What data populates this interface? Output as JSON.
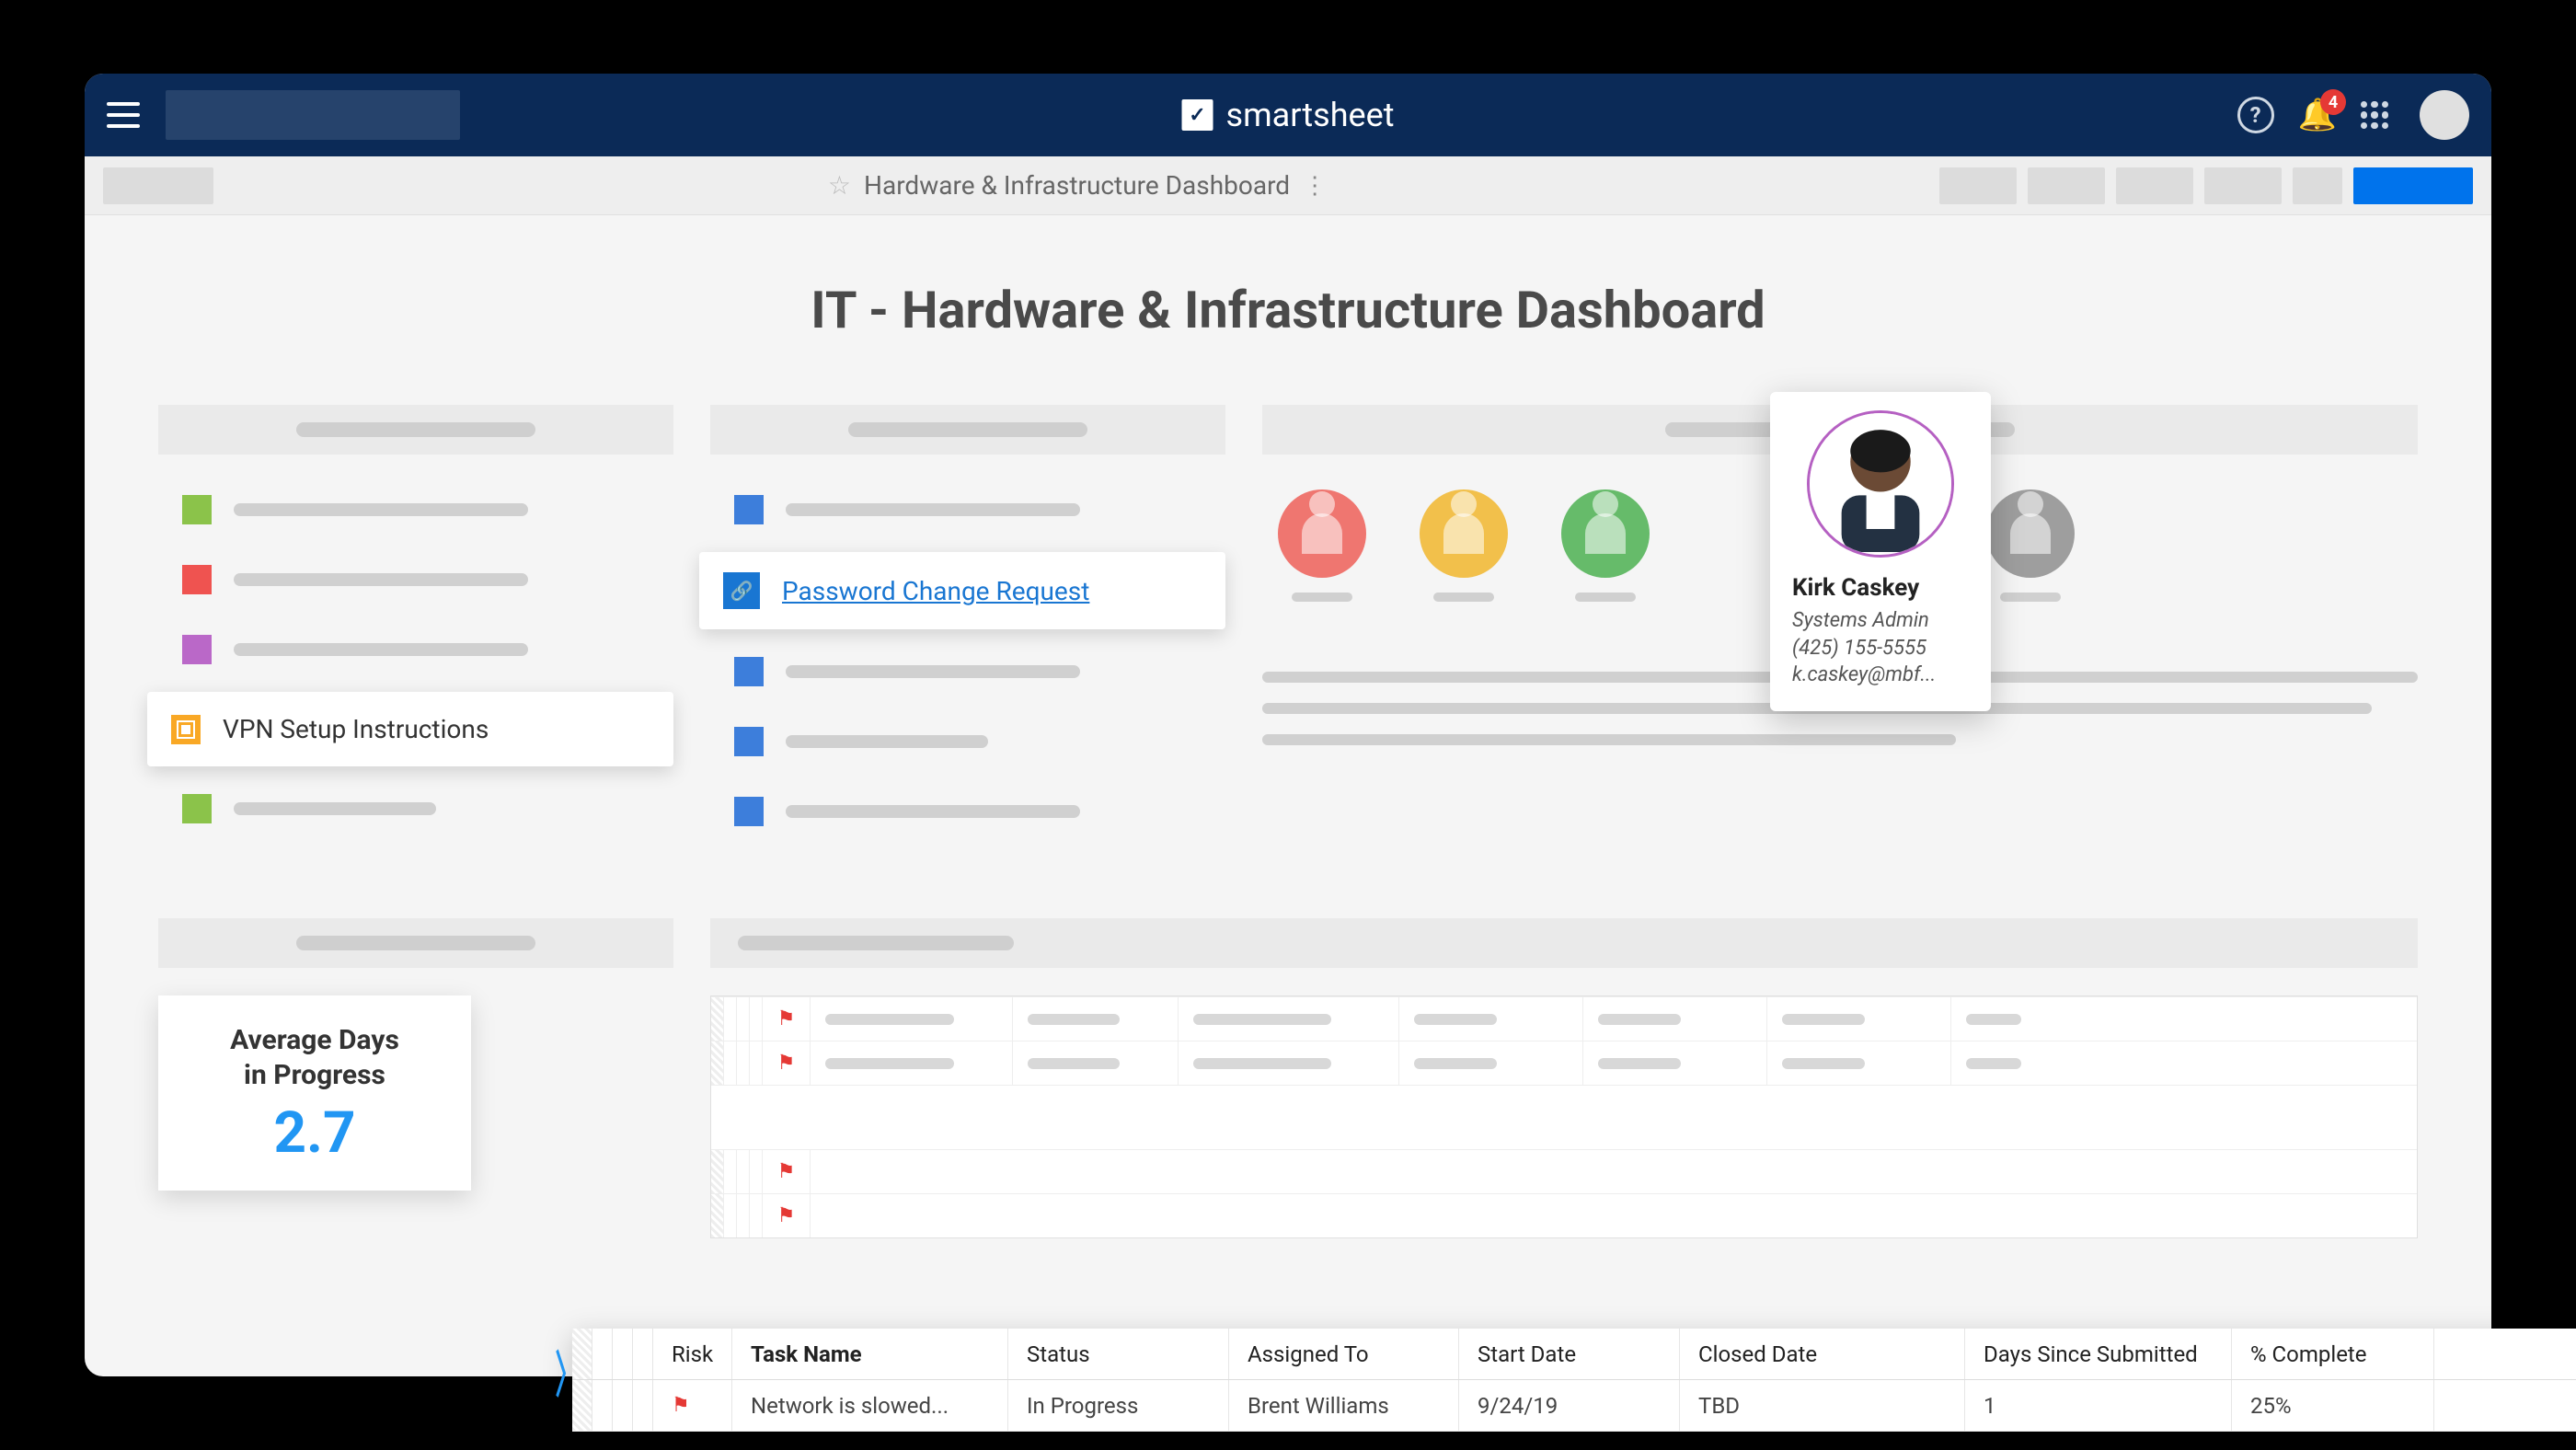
{
  "nav": {
    "brand": "smartsheet",
    "notification_count": "4"
  },
  "toolbar": {
    "title": "Hardware & Infrastructure Dashboard"
  },
  "page": {
    "title": "IT - Hardware & Infrastructure Dashboard"
  },
  "links": {
    "vpn": "VPN Setup Instructions",
    "password_change": "Password Change Request"
  },
  "popover": {
    "name": "Kirk Caskey",
    "role": "Systems Admin",
    "phone": "(425) 155-5555",
    "email": "k.caskey@mbf..."
  },
  "metric": {
    "label_line1": "Average Days",
    "label_line2": "in Progress",
    "value": "2.7"
  },
  "grid": {
    "headers": {
      "risk": "Risk",
      "task": "Task Name",
      "status": "Status",
      "assigned": "Assigned To",
      "start": "Start Date",
      "closed": "Closed Date",
      "days": "Days Since Submitted",
      "pct": "% Complete"
    },
    "row": {
      "task": "Network is slowed...",
      "status": "In Progress",
      "assigned": "Brent Williams",
      "start": "9/24/19",
      "closed": "TBD",
      "days": "1",
      "pct": "25%"
    }
  }
}
